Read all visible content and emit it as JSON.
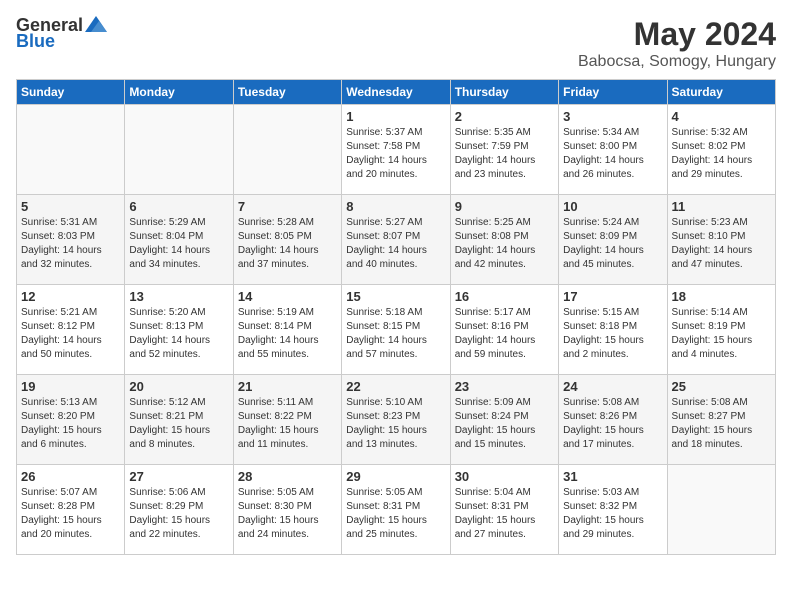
{
  "logo": {
    "general": "General",
    "blue": "Blue"
  },
  "title": "May 2024",
  "location": "Babocsa, Somogy, Hungary",
  "days_of_week": [
    "Sunday",
    "Monday",
    "Tuesday",
    "Wednesday",
    "Thursday",
    "Friday",
    "Saturday"
  ],
  "weeks": [
    [
      {
        "day": "",
        "sunrise": "",
        "sunset": "",
        "daylight": ""
      },
      {
        "day": "",
        "sunrise": "",
        "sunset": "",
        "daylight": ""
      },
      {
        "day": "",
        "sunrise": "",
        "sunset": "",
        "daylight": ""
      },
      {
        "day": "1",
        "sunrise": "Sunrise: 5:37 AM",
        "sunset": "Sunset: 7:58 PM",
        "daylight": "Daylight: 14 hours and 20 minutes."
      },
      {
        "day": "2",
        "sunrise": "Sunrise: 5:35 AM",
        "sunset": "Sunset: 7:59 PM",
        "daylight": "Daylight: 14 hours and 23 minutes."
      },
      {
        "day": "3",
        "sunrise": "Sunrise: 5:34 AM",
        "sunset": "Sunset: 8:00 PM",
        "daylight": "Daylight: 14 hours and 26 minutes."
      },
      {
        "day": "4",
        "sunrise": "Sunrise: 5:32 AM",
        "sunset": "Sunset: 8:02 PM",
        "daylight": "Daylight: 14 hours and 29 minutes."
      }
    ],
    [
      {
        "day": "5",
        "sunrise": "Sunrise: 5:31 AM",
        "sunset": "Sunset: 8:03 PM",
        "daylight": "Daylight: 14 hours and 32 minutes."
      },
      {
        "day": "6",
        "sunrise": "Sunrise: 5:29 AM",
        "sunset": "Sunset: 8:04 PM",
        "daylight": "Daylight: 14 hours and 34 minutes."
      },
      {
        "day": "7",
        "sunrise": "Sunrise: 5:28 AM",
        "sunset": "Sunset: 8:05 PM",
        "daylight": "Daylight: 14 hours and 37 minutes."
      },
      {
        "day": "8",
        "sunrise": "Sunrise: 5:27 AM",
        "sunset": "Sunset: 8:07 PM",
        "daylight": "Daylight: 14 hours and 40 minutes."
      },
      {
        "day": "9",
        "sunrise": "Sunrise: 5:25 AM",
        "sunset": "Sunset: 8:08 PM",
        "daylight": "Daylight: 14 hours and 42 minutes."
      },
      {
        "day": "10",
        "sunrise": "Sunrise: 5:24 AM",
        "sunset": "Sunset: 8:09 PM",
        "daylight": "Daylight: 14 hours and 45 minutes."
      },
      {
        "day": "11",
        "sunrise": "Sunrise: 5:23 AM",
        "sunset": "Sunset: 8:10 PM",
        "daylight": "Daylight: 14 hours and 47 minutes."
      }
    ],
    [
      {
        "day": "12",
        "sunrise": "Sunrise: 5:21 AM",
        "sunset": "Sunset: 8:12 PM",
        "daylight": "Daylight: 14 hours and 50 minutes."
      },
      {
        "day": "13",
        "sunrise": "Sunrise: 5:20 AM",
        "sunset": "Sunset: 8:13 PM",
        "daylight": "Daylight: 14 hours and 52 minutes."
      },
      {
        "day": "14",
        "sunrise": "Sunrise: 5:19 AM",
        "sunset": "Sunset: 8:14 PM",
        "daylight": "Daylight: 14 hours and 55 minutes."
      },
      {
        "day": "15",
        "sunrise": "Sunrise: 5:18 AM",
        "sunset": "Sunset: 8:15 PM",
        "daylight": "Daylight: 14 hours and 57 minutes."
      },
      {
        "day": "16",
        "sunrise": "Sunrise: 5:17 AM",
        "sunset": "Sunset: 8:16 PM",
        "daylight": "Daylight: 14 hours and 59 minutes."
      },
      {
        "day": "17",
        "sunrise": "Sunrise: 5:15 AM",
        "sunset": "Sunset: 8:18 PM",
        "daylight": "Daylight: 15 hours and 2 minutes."
      },
      {
        "day": "18",
        "sunrise": "Sunrise: 5:14 AM",
        "sunset": "Sunset: 8:19 PM",
        "daylight": "Daylight: 15 hours and 4 minutes."
      }
    ],
    [
      {
        "day": "19",
        "sunrise": "Sunrise: 5:13 AM",
        "sunset": "Sunset: 8:20 PM",
        "daylight": "Daylight: 15 hours and 6 minutes."
      },
      {
        "day": "20",
        "sunrise": "Sunrise: 5:12 AM",
        "sunset": "Sunset: 8:21 PM",
        "daylight": "Daylight: 15 hours and 8 minutes."
      },
      {
        "day": "21",
        "sunrise": "Sunrise: 5:11 AM",
        "sunset": "Sunset: 8:22 PM",
        "daylight": "Daylight: 15 hours and 11 minutes."
      },
      {
        "day": "22",
        "sunrise": "Sunrise: 5:10 AM",
        "sunset": "Sunset: 8:23 PM",
        "daylight": "Daylight: 15 hours and 13 minutes."
      },
      {
        "day": "23",
        "sunrise": "Sunrise: 5:09 AM",
        "sunset": "Sunset: 8:24 PM",
        "daylight": "Daylight: 15 hours and 15 minutes."
      },
      {
        "day": "24",
        "sunrise": "Sunrise: 5:08 AM",
        "sunset": "Sunset: 8:26 PM",
        "daylight": "Daylight: 15 hours and 17 minutes."
      },
      {
        "day": "25",
        "sunrise": "Sunrise: 5:08 AM",
        "sunset": "Sunset: 8:27 PM",
        "daylight": "Daylight: 15 hours and 18 minutes."
      }
    ],
    [
      {
        "day": "26",
        "sunrise": "Sunrise: 5:07 AM",
        "sunset": "Sunset: 8:28 PM",
        "daylight": "Daylight: 15 hours and 20 minutes."
      },
      {
        "day": "27",
        "sunrise": "Sunrise: 5:06 AM",
        "sunset": "Sunset: 8:29 PM",
        "daylight": "Daylight: 15 hours and 22 minutes."
      },
      {
        "day": "28",
        "sunrise": "Sunrise: 5:05 AM",
        "sunset": "Sunset: 8:30 PM",
        "daylight": "Daylight: 15 hours and 24 minutes."
      },
      {
        "day": "29",
        "sunrise": "Sunrise: 5:05 AM",
        "sunset": "Sunset: 8:31 PM",
        "daylight": "Daylight: 15 hours and 25 minutes."
      },
      {
        "day": "30",
        "sunrise": "Sunrise: 5:04 AM",
        "sunset": "Sunset: 8:31 PM",
        "daylight": "Daylight: 15 hours and 27 minutes."
      },
      {
        "day": "31",
        "sunrise": "Sunrise: 5:03 AM",
        "sunset": "Sunset: 8:32 PM",
        "daylight": "Daylight: 15 hours and 29 minutes."
      },
      {
        "day": "",
        "sunrise": "",
        "sunset": "",
        "daylight": ""
      }
    ]
  ]
}
